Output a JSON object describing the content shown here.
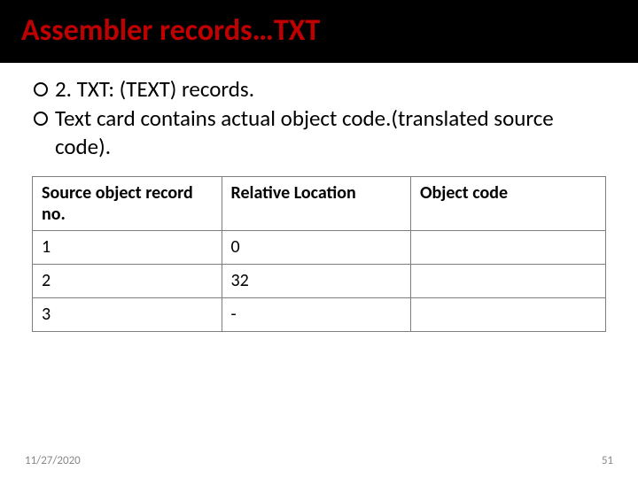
{
  "title": "Assembler records…TXT",
  "bullets": [
    "2. TXT: (TEXT) records.",
    "Text card contains actual object code.(translated source code)."
  ],
  "table": {
    "headers": [
      "Source object record no.",
      "Relative Location",
      "Object code"
    ],
    "rows": [
      [
        "1",
        "0",
        ""
      ],
      [
        "2",
        "32",
        ""
      ],
      [
        "3",
        "-",
        ""
      ]
    ]
  },
  "footer": {
    "date": "11/27/2020",
    "page": "51"
  },
  "chart_data": {
    "type": "table",
    "title": "Assembler records…TXT",
    "columns": [
      "Source object record no.",
      "Relative Location",
      "Object code"
    ],
    "rows": [
      {
        "Source object record no.": "1",
        "Relative Location": "0",
        "Object code": ""
      },
      {
        "Source object record no.": "2",
        "Relative Location": "32",
        "Object code": ""
      },
      {
        "Source object record no.": "3",
        "Relative Location": "-",
        "Object code": ""
      }
    ]
  }
}
